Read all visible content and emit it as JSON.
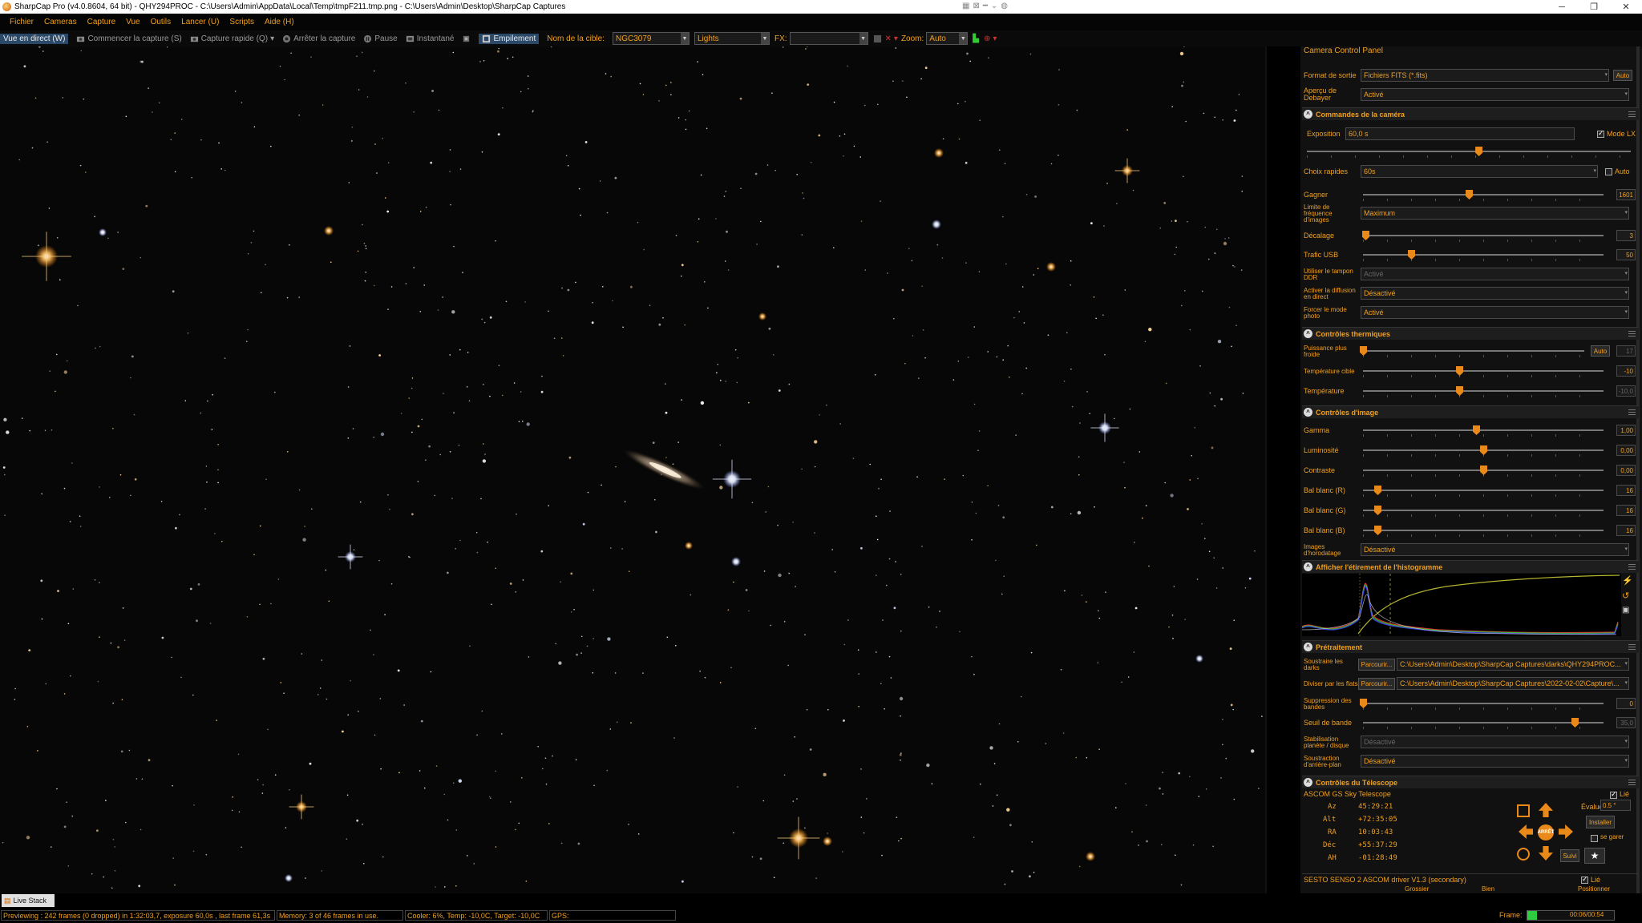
{
  "titlebar": {
    "title": "SharpCap Pro (v4.0.8604, 64 bit) - QHY294PROC - C:\\Users\\Admin\\AppData\\Local\\Temp\\tmpF211.tmp.png - C:\\Users\\Admin\\Desktop\\SharpCap Captures"
  },
  "menu": [
    "Fichier",
    "Cameras",
    "Capture",
    "Vue",
    "Outils",
    "Lancer (U)",
    "Scripts",
    "Aide (H)"
  ],
  "toolbar": {
    "live_view": "Vue en direct (W)",
    "start_capture": "Commencer la capture (S)",
    "quick_capture": "Capture rapide (Q)",
    "stop_capture": "Arrêter la capture",
    "pause": "Pause",
    "snapshot": "Instantané",
    "stacking": "Empilement",
    "target_label": "Nom de la cible:",
    "target_value": "NGC3079",
    "frame_type": "Lights",
    "fx_label": "FX:",
    "fx_value": "",
    "zoom_label": "Zoom:",
    "zoom_value": "Auto"
  },
  "panel": {
    "title": "Camera Control Panel",
    "output_format": {
      "label": "Format de sortie",
      "value": "Fichiers FITS (*.fits)",
      "button": "Auto"
    },
    "debayer": {
      "label": "Aperçu de Debayer",
      "value": "Activé"
    },
    "sections": {
      "camera": "Commandes de la caméra",
      "thermal": "Contrôles thermiques",
      "image": "Contrôles d'image",
      "histogram": "Afficher l'étirement de l'histogramme",
      "preprocessing": "Prétraitement",
      "telescope": "Contrôles du Télescope"
    },
    "exposure": {
      "label": "Exposition",
      "value": "60,0 s",
      "lx_label": "Mode LX",
      "lx_checked": true,
      "level": 0.53
    },
    "quick_choice": {
      "label": "Choix rapides",
      "value": "60s",
      "auto_label": "Auto"
    },
    "gain": {
      "label": "Gagner",
      "value": "1601",
      "level": 0.44
    },
    "frame_rate_limit": {
      "label": "Limite de fréquence d'images",
      "value": "Maximum"
    },
    "offset": {
      "label": "Décalage",
      "value": "3",
      "level": 0.01
    },
    "usb_traffic": {
      "label": "Trafic USB",
      "value": "50",
      "level": 0.2
    },
    "ddr_buffer": {
      "label": "Utiliser le tampon DDR",
      "value": "Activé"
    },
    "live_broadcast": {
      "label": "Activer la diffusion en direct",
      "value": "Désactivé"
    },
    "force_photo": {
      "label": "Forcer le mode photo",
      "value": "Activé"
    },
    "cooler_power": {
      "label": "Puissance plus froide",
      "value": "17",
      "button": "Auto",
      "level": 0.0
    },
    "target_temp": {
      "label": "Température cible",
      "value": "-10",
      "level": 0.4
    },
    "temperature": {
      "label": "Température",
      "value": "-10,0",
      "level": 0.4
    },
    "gamma": {
      "label": "Gamma",
      "value": "1,00",
      "level": 0.47
    },
    "brightness": {
      "label": "Luminosité",
      "value": "0,00",
      "level": 0.5
    },
    "contrast": {
      "label": "Contraste",
      "value": "0,00",
      "level": 0.5
    },
    "wb_r": {
      "label": "Bal blanc (R)",
      "value": "16",
      "level": 0.06
    },
    "wb_g": {
      "label": "Bal blanc (G)",
      "value": "16",
      "level": 0.06
    },
    "wb_b": {
      "label": "Bal blanc (B)",
      "value": "16",
      "level": 0.06
    },
    "timestamp": {
      "label": "Images d'horodatage",
      "value": "Désactivé"
    },
    "darks": {
      "label": "Soustraire les darks",
      "button": "Parcourir...",
      "value": "C:\\Users\\Admin\\Desktop\\SharpCap Captures\\darks\\QHY294PROC..."
    },
    "flats": {
      "label": "Diviser par les flats",
      "button": "Parcourir...",
      "value": "C:\\Users\\Admin\\Desktop\\SharpCap Captures\\2022-02-02\\Capture\\..."
    },
    "banding": {
      "label": "Suppression des bandes",
      "value": "0",
      "level": 0.0
    },
    "band_threshold": {
      "label": "Seuil de bande",
      "value": "35,0",
      "level": 0.88
    },
    "stabilization": {
      "label": "Stabilisation planète / disque",
      "value": "Désactivé"
    },
    "background_sub": {
      "label": "Soustraction d'arrière-plan",
      "value": "Désactivé"
    },
    "telescope": {
      "driver": "ASCOM GS Sky Telescope",
      "linked_label": "Lié",
      "rows": [
        {
          "k": "Az",
          "v": "45:29:21"
        },
        {
          "k": "Alt",
          "v": "+72:35:05"
        },
        {
          "k": "RA",
          "v": "10:03:43"
        },
        {
          "k": "Déc",
          "v": "+55:37:29"
        },
        {
          "k": "AH",
          "v": "-01:28:49"
        }
      ],
      "rate_label": "Évaluer",
      "rate_value": "0.5 °",
      "install_button": "Installer",
      "park_label": "se garer",
      "follow_button": "Suivi",
      "stop_label": "ARRÊT"
    },
    "focuser": {
      "driver": "SESTO SENSO 2 ASCOM driver V1.3 (secondary)",
      "linked_label": "Lié",
      "coarse": "Grossier",
      "fine": "Bien",
      "position": "Positionner"
    }
  },
  "tabs": {
    "live_stack": "Live Stack"
  },
  "status": {
    "preview": "Previewing : 242 frames (0 dropped) in 1:32:03,7, exposure 60,0s , last frame 61,3s",
    "memory": "Memory: 3 of 46 frames in use.",
    "cooler": "Cooler: 6%, Temp: -10,0C, Target: -10,0C",
    "gps": "GPS:",
    "frame_label": "Frame:",
    "frame_time": "00:06/00:54",
    "frame_progress": 0.11
  },
  "colors": {
    "accent": "#f0a020",
    "panel_bg": "#111111",
    "live_button": "#2b4a6a"
  }
}
